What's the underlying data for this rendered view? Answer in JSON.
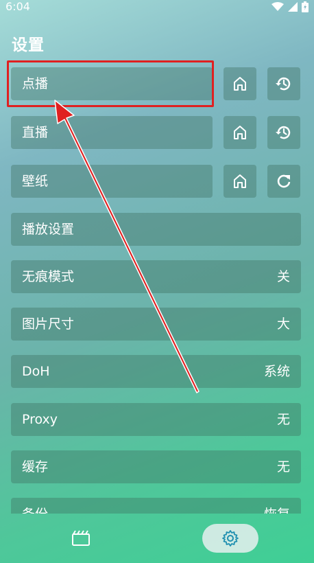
{
  "status_bar": {
    "time": "6:04"
  },
  "page": {
    "title": "设置"
  },
  "settings": {
    "vod": {
      "label": "点播"
    },
    "live": {
      "label": "直播"
    },
    "wallpaper": {
      "label": "壁纸"
    },
    "playback": {
      "label": "播放设置"
    },
    "incognito": {
      "label": "无痕模式",
      "value": "关"
    },
    "image_size": {
      "label": "图片尺寸",
      "value": "大"
    },
    "doh": {
      "label": "DoH",
      "value": "系统"
    },
    "proxy": {
      "label": "Proxy",
      "value": "无"
    },
    "cache": {
      "label": "缓存",
      "value": "无"
    },
    "backup": {
      "label": "备份",
      "value": "恢复"
    }
  },
  "icons": {
    "home": "home-icon",
    "history": "history-icon",
    "refresh": "refresh-icon",
    "film": "film-icon",
    "settings": "gear-icon"
  },
  "colors": {
    "highlight": "#e02020",
    "accent": "#1f8fb0"
  }
}
